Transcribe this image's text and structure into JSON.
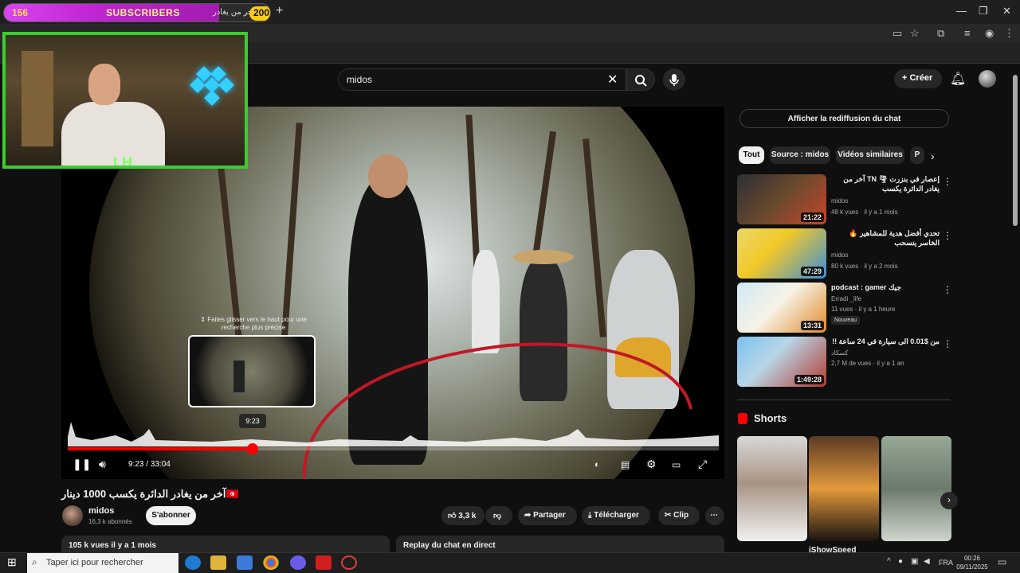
{
  "browser": {
    "tab": {
      "sub_count": "156",
      "sub_label": "SUBSCRIBERS",
      "sub_goal": "200",
      "title": "آخر من يغادر"
    },
    "new_tab": "+",
    "window_controls": [
      "—",
      "❐",
      "✕"
    ]
  },
  "header": {
    "search_value": "midos",
    "clear": "✕",
    "create_label": "Créer"
  },
  "webcam": {
    "logo": "LH"
  },
  "player": {
    "hover_hint": "⇕ Faites glisser vers le haut pour une recherche plus précise",
    "hover_time": "9:23",
    "time": "9:23 / 33:04",
    "progress": 0.284,
    "buffered": 0.284
  },
  "video": {
    "title": "آخر من يغادر الدائرة يكسب 1000 دينار🇹🇳",
    "channel": "midos",
    "subscribers": "16,3 k abonnés",
    "subscribe_label": "S'abonner",
    "likes": "3,3 k",
    "share_label": "Partager",
    "download_label": "Télécharger",
    "clip_label": "Clip",
    "views": "105 k vues  il y a 1 mois",
    "replay_label": "Replay du chat en direct"
  },
  "sidebar": {
    "chat_replay_label": "Afficher la rediffusion du chat",
    "chips": [
      "Tout",
      "Source : midos",
      "Vidéos similaires",
      "P"
    ],
    "recommendations": [
      {
        "title": "إعصار في بنزرت 🌪 TN آخر من يغادر الدائرة يكسب",
        "channel": "midos",
        "meta": "48 k vues · il y a 1 mois",
        "duration": "21:22"
      },
      {
        "title": "تحدي أفضل هدية للمشاهير 🔥 الخاسر ينسحب",
        "channel": "midos",
        "meta": "80 k vues · il y a 2 mois",
        "duration": "47:29"
      },
      {
        "title": "podcast : gamer جيك",
        "channel": "Erradi _life",
        "meta": "11 vues · il y a 1 heure",
        "duration": "13:31",
        "badge": "Nouveau"
      },
      {
        "title": "من $0.01 الى سيارة في 24 ساعة !!",
        "channel": "كسكاد",
        "meta": "2,7 M de vues · il y a 1 an",
        "duration": "1:49:28"
      }
    ],
    "shorts_label": "Shorts",
    "shorts": [
      {
        "label": ""
      },
      {
        "label": "iShowSpeed"
      },
      {
        "label": ""
      }
    ]
  },
  "taskbar": {
    "search_placeholder": "Taper ici pour rechercher",
    "lang": "FRA",
    "time": "00:26",
    "date": "09/11/2025"
  }
}
